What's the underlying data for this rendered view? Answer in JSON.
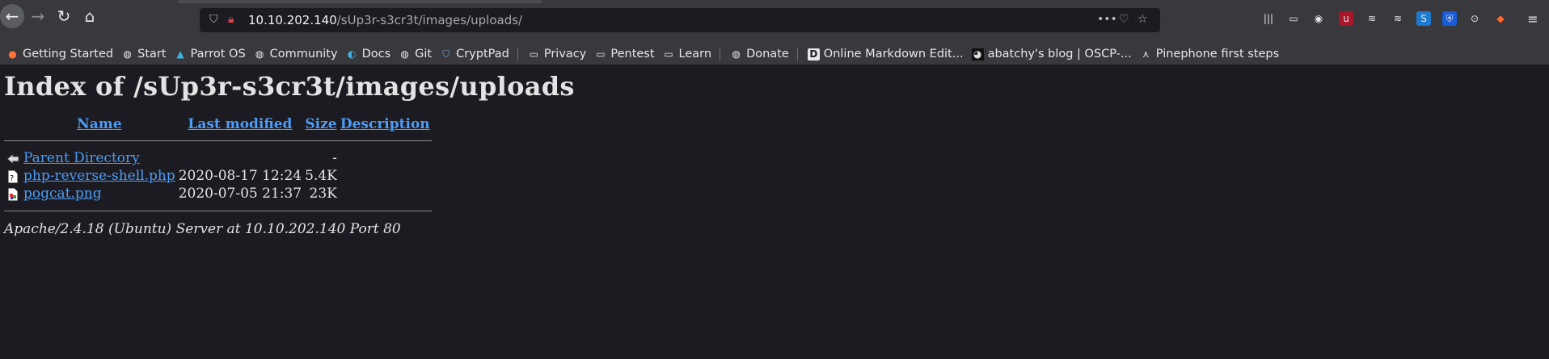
{
  "browser": {
    "url_host": "10.10.202.140",
    "url_path": "/sUp3r-s3cr3t/images/uploads/"
  },
  "bookmarks": [
    {
      "label": "Getting Started",
      "icon": "firefox-icon"
    },
    {
      "label": "Start",
      "icon": "globe-icon"
    },
    {
      "label": "Parrot OS",
      "icon": "parrot-icon"
    },
    {
      "label": "Community",
      "icon": "globe-icon"
    },
    {
      "label": "Docs",
      "icon": "docs-icon"
    },
    {
      "label": "Git",
      "icon": "globe-icon"
    },
    {
      "label": "CryptPad",
      "icon": "cryptpad-icon"
    },
    {
      "label": "Privacy",
      "icon": "folder-icon"
    },
    {
      "label": "Pentest",
      "icon": "folder-icon"
    },
    {
      "label": "Learn",
      "icon": "folder-icon"
    },
    {
      "label": "Donate",
      "icon": "globe-icon"
    },
    {
      "label": "Online Markdown Edit...",
      "icon": "markdown-icon"
    },
    {
      "label": "abatchy's blog | OSCP-...",
      "icon": "blog-icon"
    },
    {
      "label": "Pinephone first steps",
      "icon": "pine-icon"
    }
  ],
  "page": {
    "title": "Index of /sUp3r-s3cr3t/images/uploads",
    "columns": {
      "name": "Name",
      "modified": "Last modified",
      "size": "Size",
      "description": "Description"
    },
    "rows": [
      {
        "name": "Parent Directory",
        "modified": "",
        "size": "-",
        "icon": "back-icon"
      },
      {
        "name": "php-reverse-shell.php",
        "modified": "2020-08-17 12:24",
        "size": "5.4K",
        "icon": "file-icon"
      },
      {
        "name": "pogcat.png",
        "modified": "2020-07-05 21:37",
        "size": "23K",
        "icon": "image-icon"
      }
    ],
    "footer": "Apache/2.4.18 (Ubuntu) Server at 10.10.202.140 Port 80"
  }
}
